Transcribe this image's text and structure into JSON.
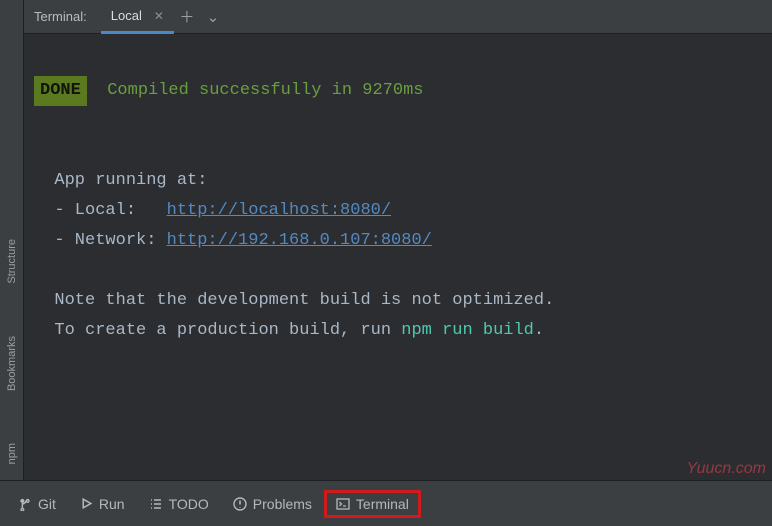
{
  "header": {
    "title": "Terminal:",
    "tab_label": "Local"
  },
  "terminal": {
    "done_label": "DONE",
    "compiled_msg": "Compiled successfully in 9270ms",
    "app_running": "App running at:",
    "local_label": "- Local:   ",
    "local_url": "http://localhost:8080/",
    "network_label": "- Network: ",
    "network_url": "http://192.168.0.107:8080/",
    "note1": "Note that the development build is not optimized.",
    "note2_prefix": "To create a production build, run ",
    "note2_cmd": "npm run build",
    "note2_suffix": "."
  },
  "left_tabs": {
    "structure": "Structure",
    "bookmarks": "Bookmarks",
    "npm": "npm"
  },
  "bottom": {
    "git": "Git",
    "run": "Run",
    "todo": "TODO",
    "problems": "Problems",
    "terminal": "Terminal"
  },
  "watermark": "Yuucn.com"
}
